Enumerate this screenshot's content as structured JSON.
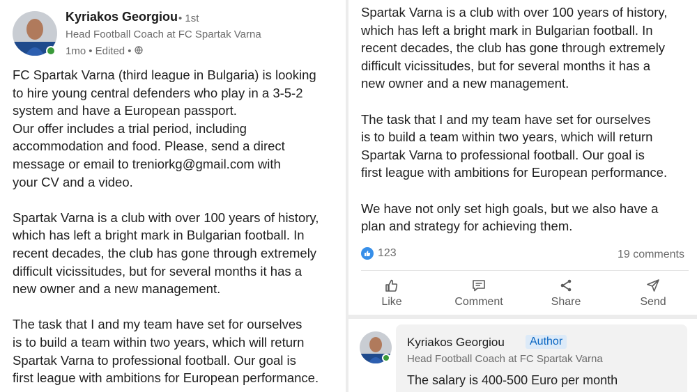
{
  "post": {
    "author_name": "Kyriakos Georgiou",
    "degree": "• 1st",
    "headline": "Head Football Coach at FC Spartak Varna",
    "time": "1mo",
    "edited": "• Edited •",
    "visibility_icon": "globe-icon",
    "left_lines": [
      "FC Spartak Varna (third league in Bulgaria) is looking",
      "to hire young central defenders who play in a 3-5-2",
      "system and have a European passport.",
      "Our offer includes a trial period, including",
      "accommodation and food. Please, send a direct",
      "message or email to treniorkg@gmail.com with",
      "your CV and a video.",
      "",
      "Spartak Varna is a club with over 100 years of history,",
      "which has left a bright mark in Bulgarian football.  In",
      "recent decades, the club has gone through extremely",
      "difficult vicissitudes, but for several months it has a",
      "new owner and a new management.",
      "",
      "The task that I and my team have set for ourselves",
      "is to build a team within two years, which will return",
      "Spartak Varna to professional football.  Our goal is",
      "first league with ambitions for European performance."
    ],
    "right_lines": [
      "Spartak Varna is a club with over 100 years of history,",
      "which has left a bright mark in Bulgarian football.  In",
      "recent decades, the club has gone through extremely",
      "difficult vicissitudes, but for several months it has a",
      "new owner and a new management.",
      "",
      "The task that I and my team have set for ourselves",
      "is to build a team within two years, which will return",
      "Spartak Varna to professional football.  Our goal is",
      "first league with ambitions for European performance.",
      "",
      "We have not only set high goals, but we also have a",
      "plan and strategy for achieving them."
    ],
    "reaction_count": "123",
    "comments_count": "19 comments"
  },
  "actions": {
    "like": "Like",
    "comment": "Comment",
    "share": "Share",
    "send": "Send"
  },
  "comment": {
    "author_name": "Kyriakos Georgiou",
    "badge": "Author",
    "headline": "Head Football Coach at FC Spartak Varna",
    "text": "The salary is 400-500 Euro per month"
  },
  "colors": {
    "accent": "#0a66c2",
    "like_blue": "#378fe9",
    "online_green": "#3a9a3a",
    "muted_text": "#6b6b6b"
  }
}
